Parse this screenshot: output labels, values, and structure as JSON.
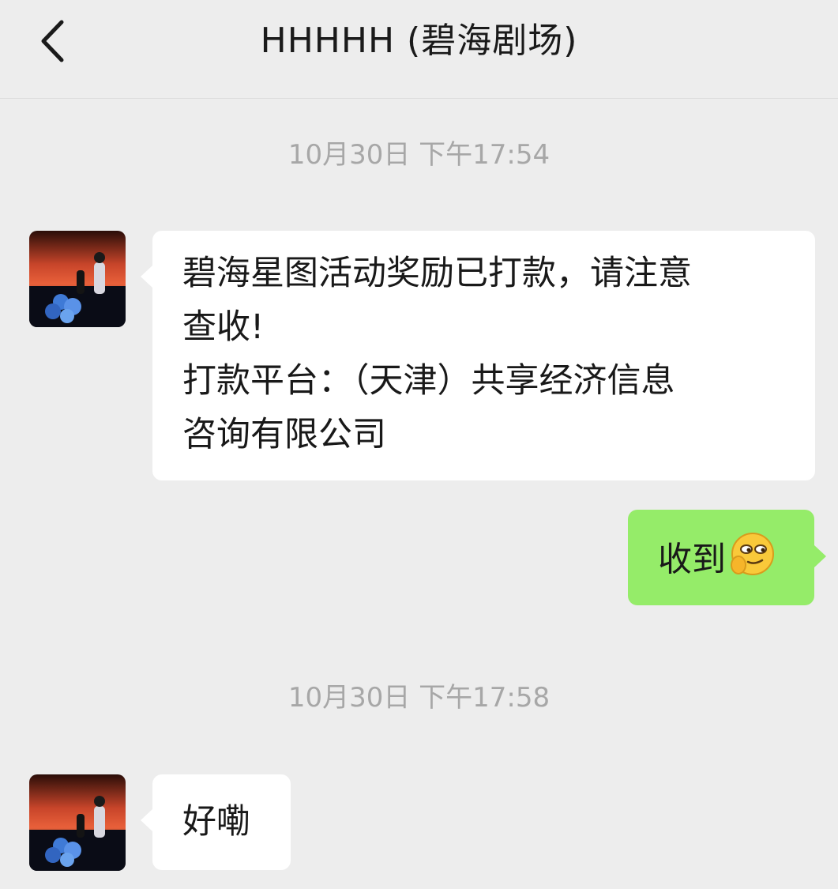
{
  "header": {
    "title": "HHHHH (碧海剧场)",
    "back_icon": "chevron-left-icon"
  },
  "messages": [
    {
      "type": "timestamp",
      "text": "10月30日 下午17:54"
    },
    {
      "type": "received",
      "text": "碧海星图活动奖励已打款，请注意\n查收!\n打款平台：（天津）共享经济信息\n咨询有限公司"
    },
    {
      "type": "sent",
      "text": "收到",
      "emoji": "smirk-face-emoji"
    },
    {
      "type": "timestamp",
      "text": "10月30日 下午17:58"
    },
    {
      "type": "received",
      "text": "好嘞"
    }
  ],
  "colors": {
    "background": "#ededed",
    "received_bubble": "#ffffff",
    "sent_bubble": "#95ec69",
    "timestamp": "#a7a7a7"
  }
}
